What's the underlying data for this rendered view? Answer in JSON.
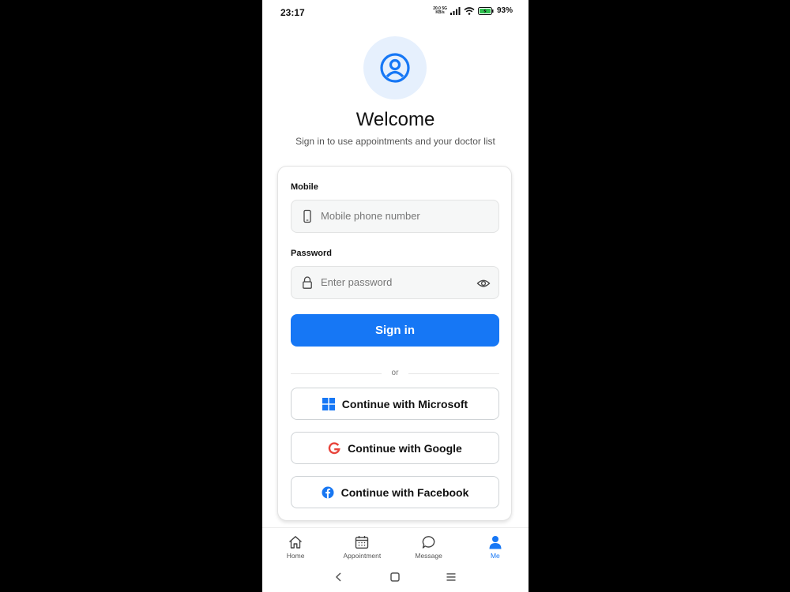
{
  "status_bar": {
    "time": "23:17",
    "net_speed_top": "20.0",
    "net_speed_bottom": "KB/s",
    "network_type": "5G",
    "battery_percent": "93%"
  },
  "header": {
    "icon": "user-circle-icon",
    "title": "Welcome",
    "subtitle": "Sign in to use appointments and your doctor list"
  },
  "form": {
    "mobile_label": "Mobile",
    "mobile_placeholder": "Mobile phone number",
    "password_label": "Password",
    "password_placeholder": "Enter password",
    "signin_label": "Sign in",
    "divider_text": "or"
  },
  "social": {
    "microsoft_label": "Continue with Microsoft",
    "google_label": "Continue with Google",
    "facebook_label": "Continue with Facebook"
  },
  "tabs": [
    {
      "label": "Home",
      "icon": "home-icon",
      "active": false
    },
    {
      "label": "Appointment",
      "icon": "calendar-icon",
      "active": false
    },
    {
      "label": "Message",
      "icon": "chat-bubble-icon",
      "active": false
    },
    {
      "label": "Me",
      "icon": "person-icon",
      "active": true
    }
  ],
  "colors": {
    "accent": "#1677f5",
    "avatar_bg": "#e6f0fd",
    "field_bg": "#f6f7f7"
  }
}
